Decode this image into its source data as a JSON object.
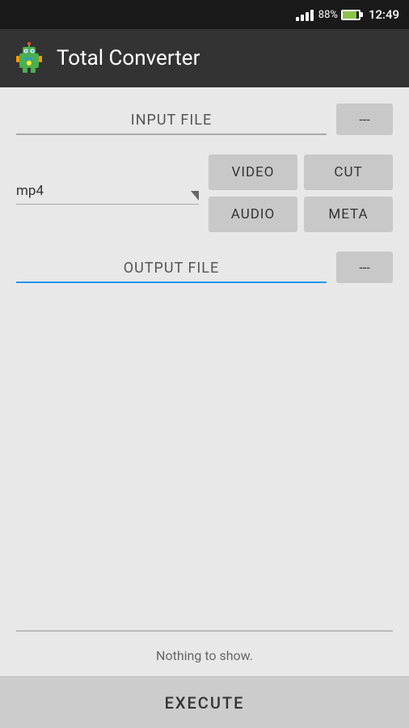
{
  "statusBar": {
    "batteryPercent": "88%",
    "time": "12:49"
  },
  "appBar": {
    "title": "Total Converter"
  },
  "inputFile": {
    "label": "INPUT FILE",
    "buttonLabel": "---",
    "underlineColor": "grey"
  },
  "formatSelector": {
    "value": "mp4"
  },
  "options": {
    "video": "VIDEO",
    "cut": "CUT",
    "audio": "AUDIO",
    "meta": "META"
  },
  "outputFile": {
    "label": "OUTPUT FILE",
    "buttonLabel": "---",
    "underlineColor": "blue"
  },
  "logArea": {
    "emptyText": "Nothing to show."
  },
  "executeButton": {
    "label": "EXECUTE"
  }
}
